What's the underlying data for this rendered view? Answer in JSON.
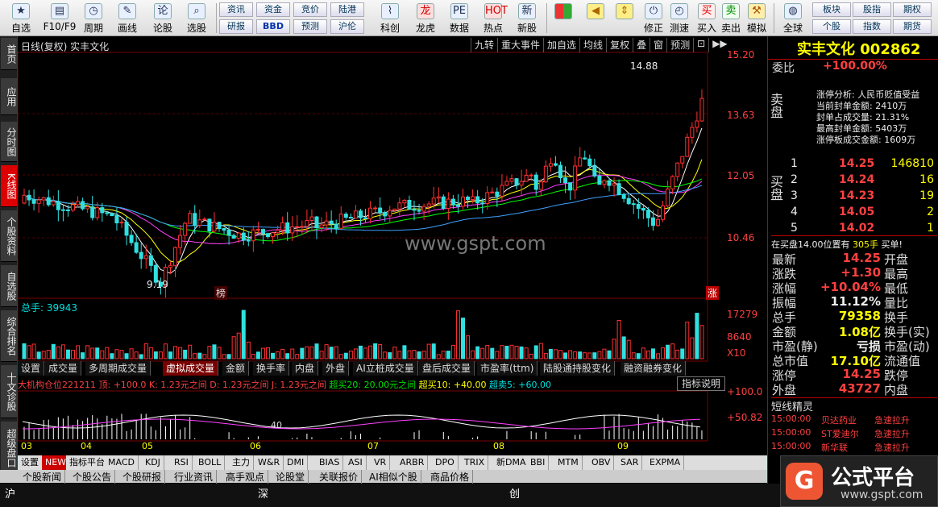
{
  "toolbar": {
    "buttons": [
      "自选",
      "F10/F9",
      "周期",
      "画线",
      "论股",
      "选股",
      "科创",
      "龙虎",
      "数据",
      "热点",
      "新股",
      "修正",
      "测速",
      "买入",
      "卖出",
      "模拟",
      "全球"
    ],
    "minis": [
      "资讯",
      "资金",
      "竞价",
      "陆港",
      "研报",
      "BBD",
      "预测",
      "沪伦",
      "板块",
      "股指",
      "期权",
      "个股",
      "指数",
      "期货"
    ]
  },
  "leftnav": [
    "首页",
    "应用",
    "分时图",
    "K线图",
    "个股资料",
    "自选股",
    "综合排名",
    "十文诊股",
    "超级盘口"
  ],
  "chart": {
    "title": "日线(复权) 实丰文化",
    "top_menu": [
      "九转",
      "重大事件",
      "加自选",
      "均线",
      "复权",
      "叠",
      "窗",
      "预测"
    ],
    "price_axis": [
      "15.20",
      "13.63",
      "12.05",
      "10.46"
    ],
    "high_label": "14.88",
    "low_label": "9.19",
    "watermark": "www.gspt.com",
    "bang": "榜",
    "zhang": "涨",
    "vol_label": "总手: 39943",
    "vol_axis": [
      "17279",
      "8640",
      "X10"
    ],
    "sub_tabs": [
      "设置",
      "成交量",
      "多周期成交量",
      "虚拟成交量",
      "金额",
      "换手率",
      "内盘",
      "外盘",
      "AI立桩成交量",
      "盘后成交量",
      "市盈率(ttm)",
      "陆股通持股变化",
      "融资融券变化"
    ],
    "ind_line": "大机构仓位221211 顶: +100.0 K: 1.23元之间 D: 1.23元之间 J: 1.23元之间",
    "ind_parts": [
      "超买20: 20.00元之间",
      "超买10: +40.00",
      "超卖5: +60.00"
    ],
    "ind_btn": "指标说明",
    "ind_axis": [
      "+100.0",
      "+50.82"
    ],
    "ind_40": "40",
    "months": [
      "03",
      "04",
      "05",
      "06",
      "07",
      "08",
      "09"
    ],
    "ind_tabs": [
      "设置",
      "NEW",
      "指标平台",
      "MACD",
      "KDJ",
      "RSI",
      "BOLL",
      "主力",
      "W&R",
      "DMI",
      "BIAS",
      "ASI",
      "VR",
      "ARBR",
      "DPO",
      "TRIX",
      "新DMA",
      "BBI",
      "MTM",
      "OBV",
      "SAR",
      "EXPMA"
    ],
    "news_tabs": [
      "个股新闻",
      "个股公告",
      "个股研报",
      "行业资讯",
      "高手观点",
      "论股堂",
      "关联报价",
      "AI相似个股",
      "商品价格"
    ],
    "status": [
      "沪",
      "深",
      "创"
    ]
  },
  "quote": {
    "name_code": "实丰文化 002862",
    "weibi_label": "委比",
    "weibi": "+100.00%",
    "sell": "卖盘",
    "buy": "买盘",
    "notes": [
      "涨停分析: 人民币贬值受益",
      "当前封单金额: 2410万",
      "封单占成交量: 21.31%",
      "最高封单金额: 5403万",
      "涨停板成交金额: 1609万"
    ],
    "bids": [
      {
        "n": "1",
        "p": "14.25",
        "v": "146810"
      },
      {
        "n": "2",
        "p": "14.24",
        "v": "16"
      },
      {
        "n": "3",
        "p": "14.23",
        "v": "19"
      },
      {
        "n": "4",
        "p": "14.05",
        "v": "2"
      },
      {
        "n": "5",
        "p": "14.02",
        "v": "1"
      }
    ],
    "bidline": "在买盘14.00位置有",
    "bidline_v": "305手",
    "bidline_s": "买单!",
    "fields": [
      {
        "l": "最新",
        "v": "14.25",
        "l2": "开盘",
        "c": "red"
      },
      {
        "l": "涨跌",
        "v": "+1.30",
        "l2": "最高",
        "c": "red"
      },
      {
        "l": "涨幅",
        "v": "+10.04%",
        "l2": "最低",
        "c": "red"
      },
      {
        "l": "振幅",
        "v": "11.12%",
        "l2": "量比",
        "c": "white"
      },
      {
        "l": "总手",
        "v": "79358",
        "l2": "换手",
        "c": "yel"
      },
      {
        "l": "金额",
        "v": "1.08亿",
        "l2": "换手(实)",
        "c": "yel"
      },
      {
        "l": "市盈(静)",
        "v": "亏损",
        "l2": "市盈(动)",
        "c": "white"
      },
      {
        "l": "总市值",
        "v": "17.10亿",
        "l2": "流通值",
        "c": "yel"
      },
      {
        "l": "涨停",
        "v": "14.25",
        "l2": "跌停",
        "c": "red"
      },
      {
        "l": "外盘",
        "v": "43727",
        "l2": "内盘",
        "c": "red"
      }
    ],
    "spirit_title": "短线精灵",
    "spirit": [
      {
        "t": "15:00:00",
        "n": "贝达药业",
        "e": "急速拉升"
      },
      {
        "t": "15:00:00",
        "n": "ST爱迪尔",
        "e": "急速拉升"
      },
      {
        "t": "15:00:00",
        "n": "新华联",
        "e": "急速拉升"
      }
    ]
  },
  "logo": "公式平台",
  "logo_url": "www.gspt.com"
}
